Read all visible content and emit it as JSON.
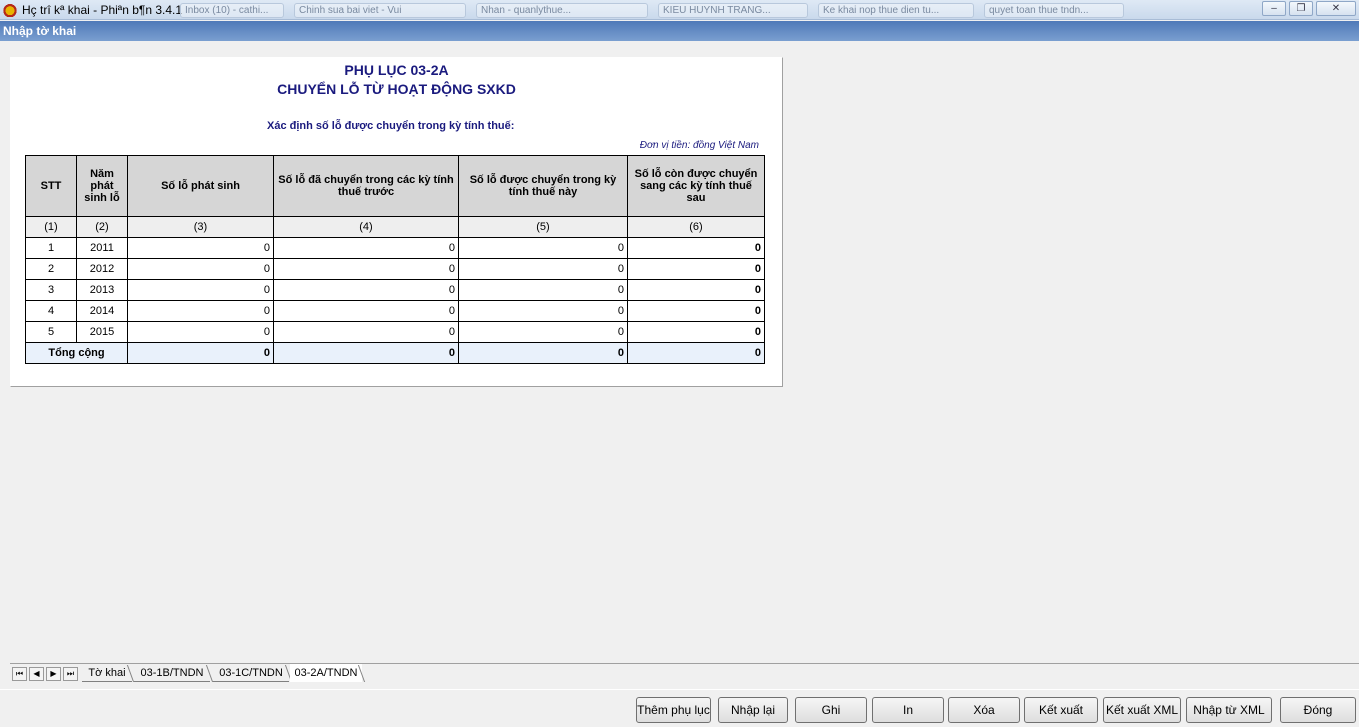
{
  "window": {
    "title": "Hç trî kª khai - Phiªn b¶n 3.4.1",
    "minimize": "–",
    "restore": "❐",
    "close": "✕",
    "ghost_tabs": [
      "Inbox (10) - cathi...",
      "Chinh sua bai viet - Vui",
      "Nhan - quanlythue...",
      "KIEU HUYNH TRANG...",
      "Ke khai nop thue dien tu...",
      "quyet toan thue tndn..."
    ]
  },
  "subbar": {
    "title": "Nhập tờ khai"
  },
  "form": {
    "title1": "PHỤ LỤC 03-2A",
    "title2": "CHUYỂN LỖ TỪ HOẠT ĐỘNG SXKD",
    "subtitle": "Xác định số lỗ được chuyển trong kỳ tính thuế:",
    "unit": "Đơn vị tiền: đồng Việt Nam",
    "headers": [
      "STT",
      "Năm phát sinh lỗ",
      "Số lỗ phát sinh",
      "Số lỗ đã chuyển trong các kỳ tính thuế trước",
      "Số lỗ được chuyển trong kỳ tính thuế này",
      "Số lỗ còn được chuyển sang các kỳ tính thuế sau"
    ],
    "index_row": [
      "(1)",
      "(2)",
      "(3)",
      "(4)",
      "(5)",
      "(6)"
    ],
    "rows": [
      {
        "stt": "1",
        "year": "2011",
        "c3": "0",
        "c4": "0",
        "c5": "0",
        "c6": "0"
      },
      {
        "stt": "2",
        "year": "2012",
        "c3": "0",
        "c4": "0",
        "c5": "0",
        "c6": "0"
      },
      {
        "stt": "3",
        "year": "2013",
        "c3": "0",
        "c4": "0",
        "c5": "0",
        "c6": "0"
      },
      {
        "stt": "4",
        "year": "2014",
        "c3": "0",
        "c4": "0",
        "c5": "0",
        "c6": "0"
      },
      {
        "stt": "5",
        "year": "2015",
        "c3": "0",
        "c4": "0",
        "c5": "0",
        "c6": "0"
      }
    ],
    "total": {
      "label": "Tổng cộng",
      "c3": "0",
      "c4": "0",
      "c5": "0",
      "c6": "0"
    }
  },
  "tabs": {
    "nav": [
      "⏮",
      "◀",
      "▶",
      "⏭"
    ],
    "items": [
      "Tờ khai",
      "03-1B/TNDN",
      "03-1C/TNDN",
      "03-2A/TNDN"
    ],
    "active": "03-2A/TNDN"
  },
  "buttons": {
    "add_appendix": "Thêm phụ lục",
    "reenter": "Nhập lại",
    "save": "Ghi",
    "print": "In",
    "delete": "Xóa",
    "export": "Kết xuất",
    "export_xml": "Kết xuất XML",
    "import_xml": "Nhập từ XML",
    "close": "Đóng"
  }
}
